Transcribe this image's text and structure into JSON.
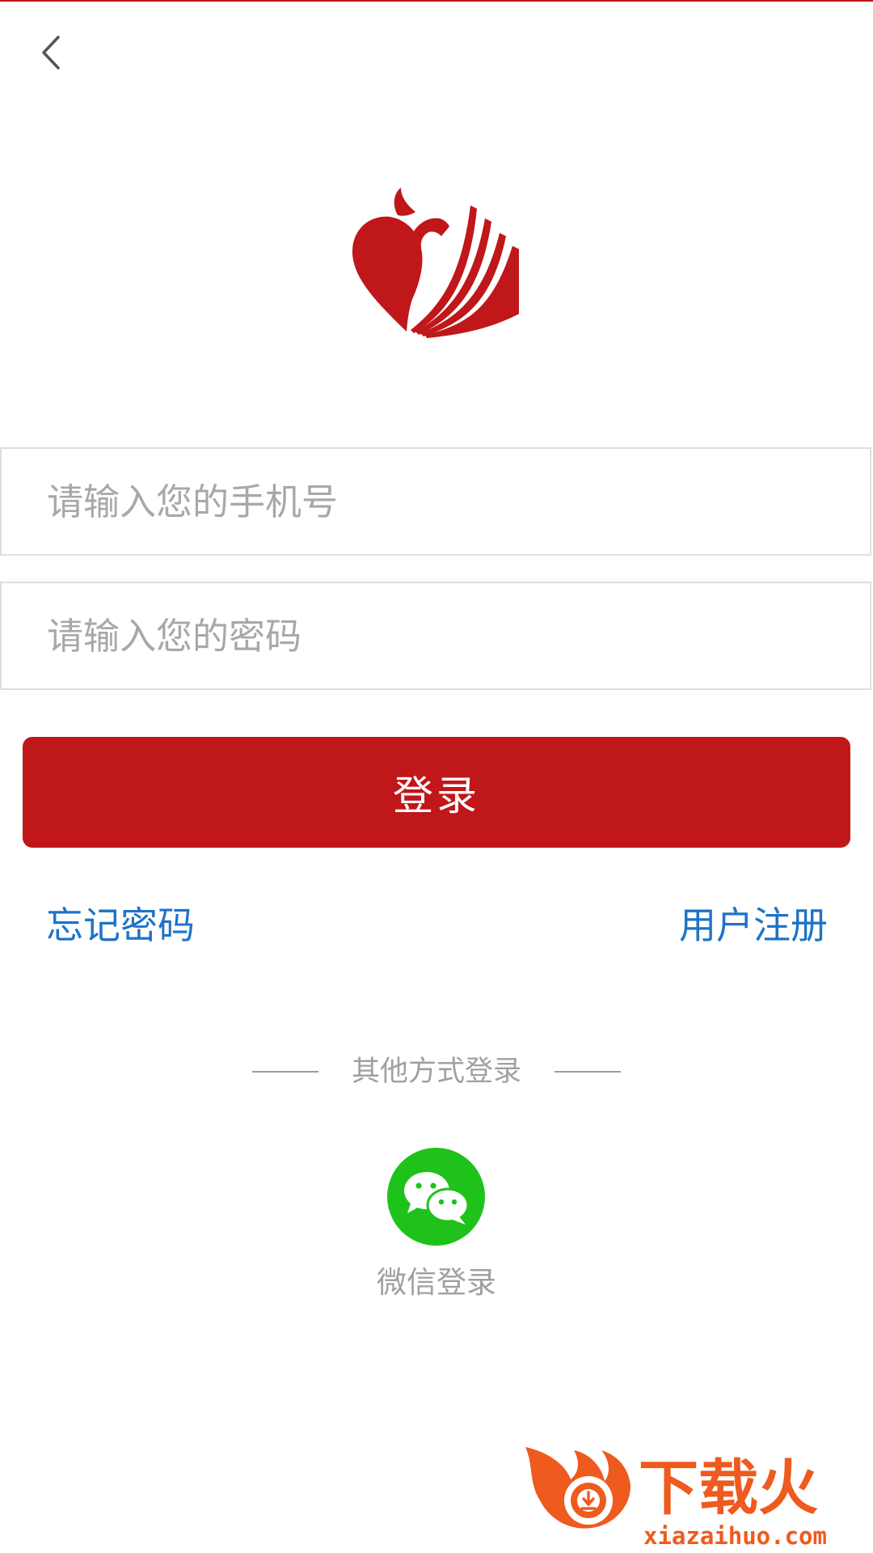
{
  "form": {
    "phone_placeholder": "请输入您的手机号",
    "password_placeholder": "请输入您的密码",
    "login_label": "登录"
  },
  "links": {
    "forgot_password": "忘记密码",
    "register": "用户注册"
  },
  "other_login": {
    "divider_text": "其他方式登录",
    "wechat_label": "微信登录",
    "wechat_icon": "wechat-icon"
  },
  "watermark": {
    "name": "下载火",
    "domain": "xiazaihuo.com"
  },
  "colors": {
    "brand_red": "#c0171a",
    "link_blue": "#1e73c8",
    "wechat_green": "#1fc21a",
    "watermark_orange": "#ef5a1e"
  }
}
